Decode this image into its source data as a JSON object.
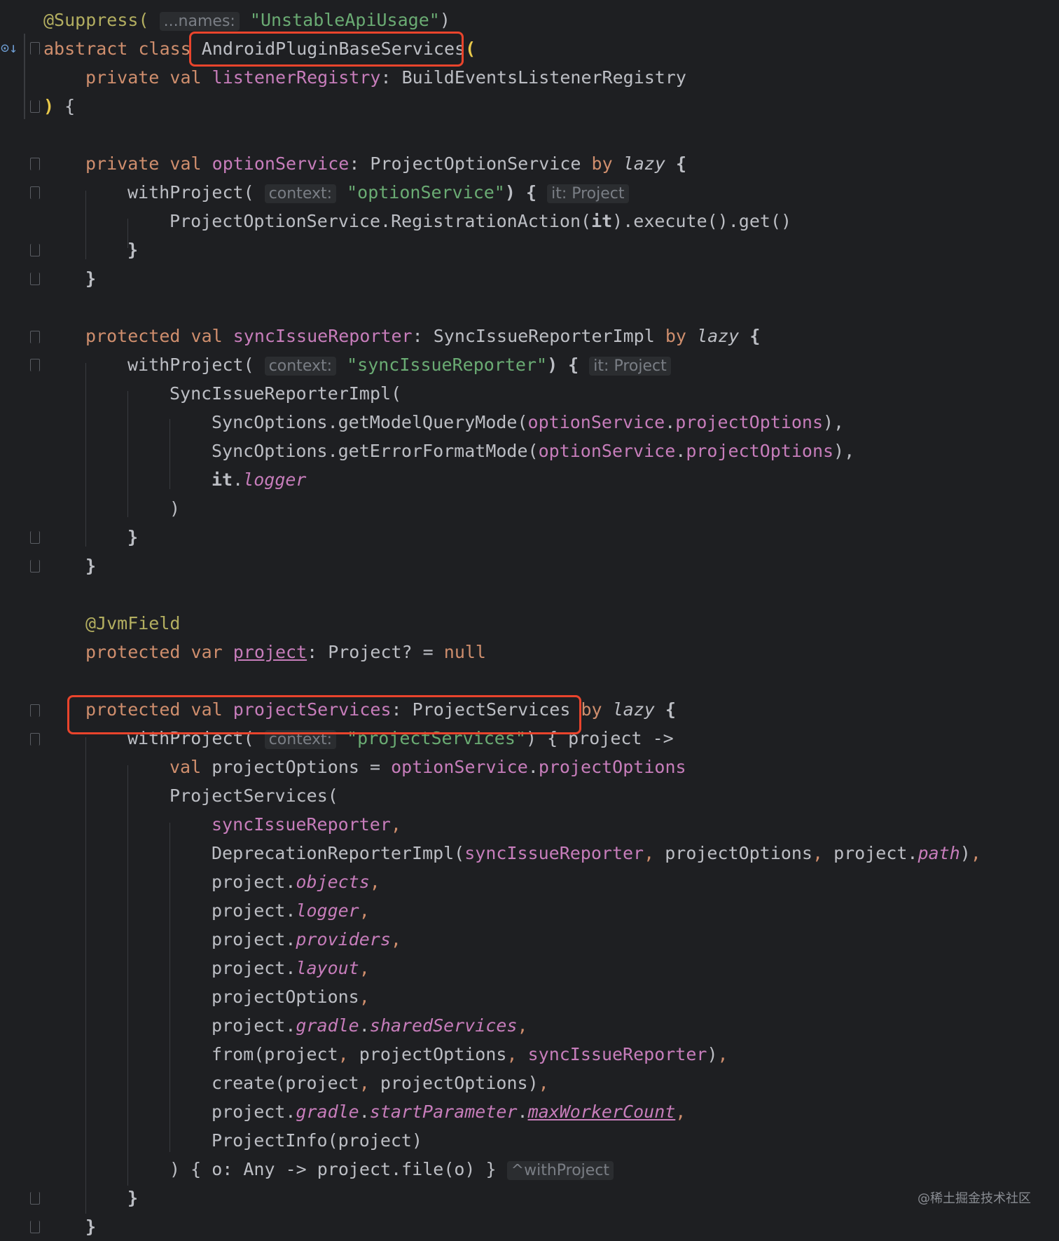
{
  "editor": {
    "language": "Kotlin",
    "colors": {
      "background": "#1e1f22",
      "keyword": "#cf8e6d",
      "annotation": "#b3ae60",
      "string": "#6aab73",
      "field": "#c77dbb",
      "text": "#bcbec4",
      "highlight_box": "#e9442c"
    },
    "gutter_icon": "override-down-arrow-icon",
    "hints": {
      "names": "...names:",
      "context": "context:",
      "it_project": "it: Project",
      "with_project": "^withProject"
    },
    "code": {
      "suppress_ann": "@Suppress(",
      "suppress_arg": "\"UnstableApiUsage\"",
      "close_paren": ")",
      "abstract_class": "abstract class",
      "class_name": "AndroidPluginBaseServices",
      "open_paren": "(",
      "private_val": "private val",
      "listener_registry": "listenerRegistry",
      "listener_type": ": BuildEventsListenerRegistry",
      "close_ctor": ")",
      "open_brace": " {",
      "option_service": "optionService",
      "option_type": ": ProjectOptionService",
      "by": "by",
      "lazy": "lazy",
      "brace": "{",
      "with_project": "withProject(",
      "option_service_str": "\"optionService\"",
      "paren_brace": ") {",
      "registration": "ProjectOptionService.RegistrationAction(",
      "it": "it",
      "execute_get": ").execute().get()",
      "close_brace": "}",
      "protected_val": "protected val",
      "sync_issue_reporter": "syncIssueReporter",
      "sync_type": ": SyncIssueReporterImpl",
      "sync_issue_reporter_str": "\"syncIssueReporter\"",
      "sync_impl": "SyncIssueReporterImpl(",
      "model_query": "SyncOptions.getModelQueryMode(",
      "error_format": "SyncOptions.getErrorFormatMode(",
      "dot": ".",
      "project_options_prop": "projectOptions",
      "paren_comma": "),",
      "logger": "logger",
      "jvm_field": "@JvmField",
      "protected_var": "protected var",
      "project": "project",
      "project_type": ": Project? = ",
      "null": "null",
      "project_services": "projectServices",
      "project_services_type": ": ProjectServices",
      "project_services_str": "\"projectServices\"",
      "project_lambda": ") { project ->",
      "val": "val",
      "project_options_assign": " projectOptions = ",
      "project_services_ctor": "ProjectServices(",
      "comma": ",",
      "deprecation": "DeprecationReporterImpl(",
      "project_options_arg": " projectOptions",
      "project_dot": "project.",
      "path": "path",
      "objects": "objects",
      "providers": "providers",
      "layout": "layout",
      "project_options_line": "projectOptions",
      "gradle": "gradle",
      "shared_services": "sharedServices",
      "from": "from(project",
      "create": "create(project",
      "start_parameter": "startParameter",
      "max_worker_count": "maxWorkerCount",
      "project_info": "ProjectInfo(project)",
      "file_lambda": ") { o: Any -> project.file(o) }"
    }
  },
  "watermark": "@稀土掘金技术社区"
}
